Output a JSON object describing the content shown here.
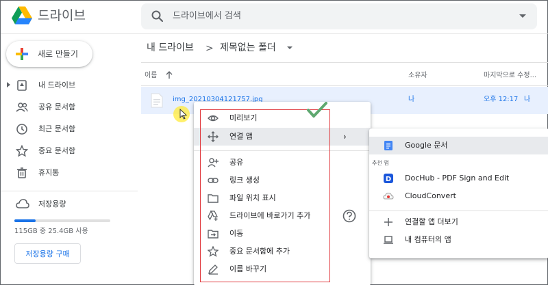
{
  "header": {
    "app_title": "드라이브",
    "search_placeholder": "드라이브에서 검색"
  },
  "sidebar": {
    "new_label": "새로 만들기",
    "items": [
      {
        "label": "내 드라이브",
        "icon": "my-drive-icon"
      },
      {
        "label": "공유 문서함",
        "icon": "shared-icon"
      },
      {
        "label": "최근 문서함",
        "icon": "clock-icon"
      },
      {
        "label": "중요 문서함",
        "icon": "star-icon"
      },
      {
        "label": "휴지통",
        "icon": "trash-icon"
      }
    ],
    "storage": {
      "label": "저장용량",
      "usage_text": "115GB 중 25.4GB 사용",
      "used_fraction": 0.22,
      "buy_label": "저장용량 구매"
    }
  },
  "breadcrumb": {
    "root": "내 드라이브",
    "separator": ">",
    "folder": "제목없는 폴더"
  },
  "table": {
    "columns": {
      "name": "이름",
      "owner": "소유자",
      "modified": "마지막으로 수정..."
    },
    "rows": [
      {
        "name": "img_20210304121757.jpg",
        "owner": "나",
        "modified": "오후 12:17",
        "modified_by": "나"
      }
    ]
  },
  "context_menu": {
    "items": [
      {
        "label": "미리보기",
        "icon": "eye-icon"
      },
      {
        "label": "연결 앱",
        "icon": "move-arrows-icon",
        "chevron": "›"
      },
      {
        "label": "공유",
        "icon": "add-person-icon"
      },
      {
        "label": "링크 생성",
        "icon": "link-icon"
      },
      {
        "label": "파일 위치 표시",
        "icon": "folder-icon"
      },
      {
        "label": "드라이브에 바로가기 추가",
        "icon": "drive-shortcut-icon"
      },
      {
        "label": "이동",
        "icon": "move-to-folder-icon"
      },
      {
        "label": "중요 문서함에 추가",
        "icon": "star-icon"
      },
      {
        "label": "이름 바꾸기",
        "icon": "pencil-icon"
      }
    ]
  },
  "submenu": {
    "items": [
      {
        "label": "Google 문서",
        "icon": "google-docs-icon"
      },
      {
        "label": "DocHub - PDF Sign and Edit",
        "icon": "dochub-icon"
      },
      {
        "label": "CloudConvert",
        "icon": "cloudconvert-icon"
      },
      {
        "label": "연결할 앱 더보기",
        "icon": "plus-icon"
      },
      {
        "label": "내 컴퓨터의 앱",
        "icon": "laptop-icon"
      }
    ],
    "section_label": "추천 앱"
  },
  "colors": {
    "accent": "#1a73e8",
    "selected_row": "#e8f0fe",
    "annotation_red": "#e0393e",
    "annotation_check": "#5fa870"
  }
}
